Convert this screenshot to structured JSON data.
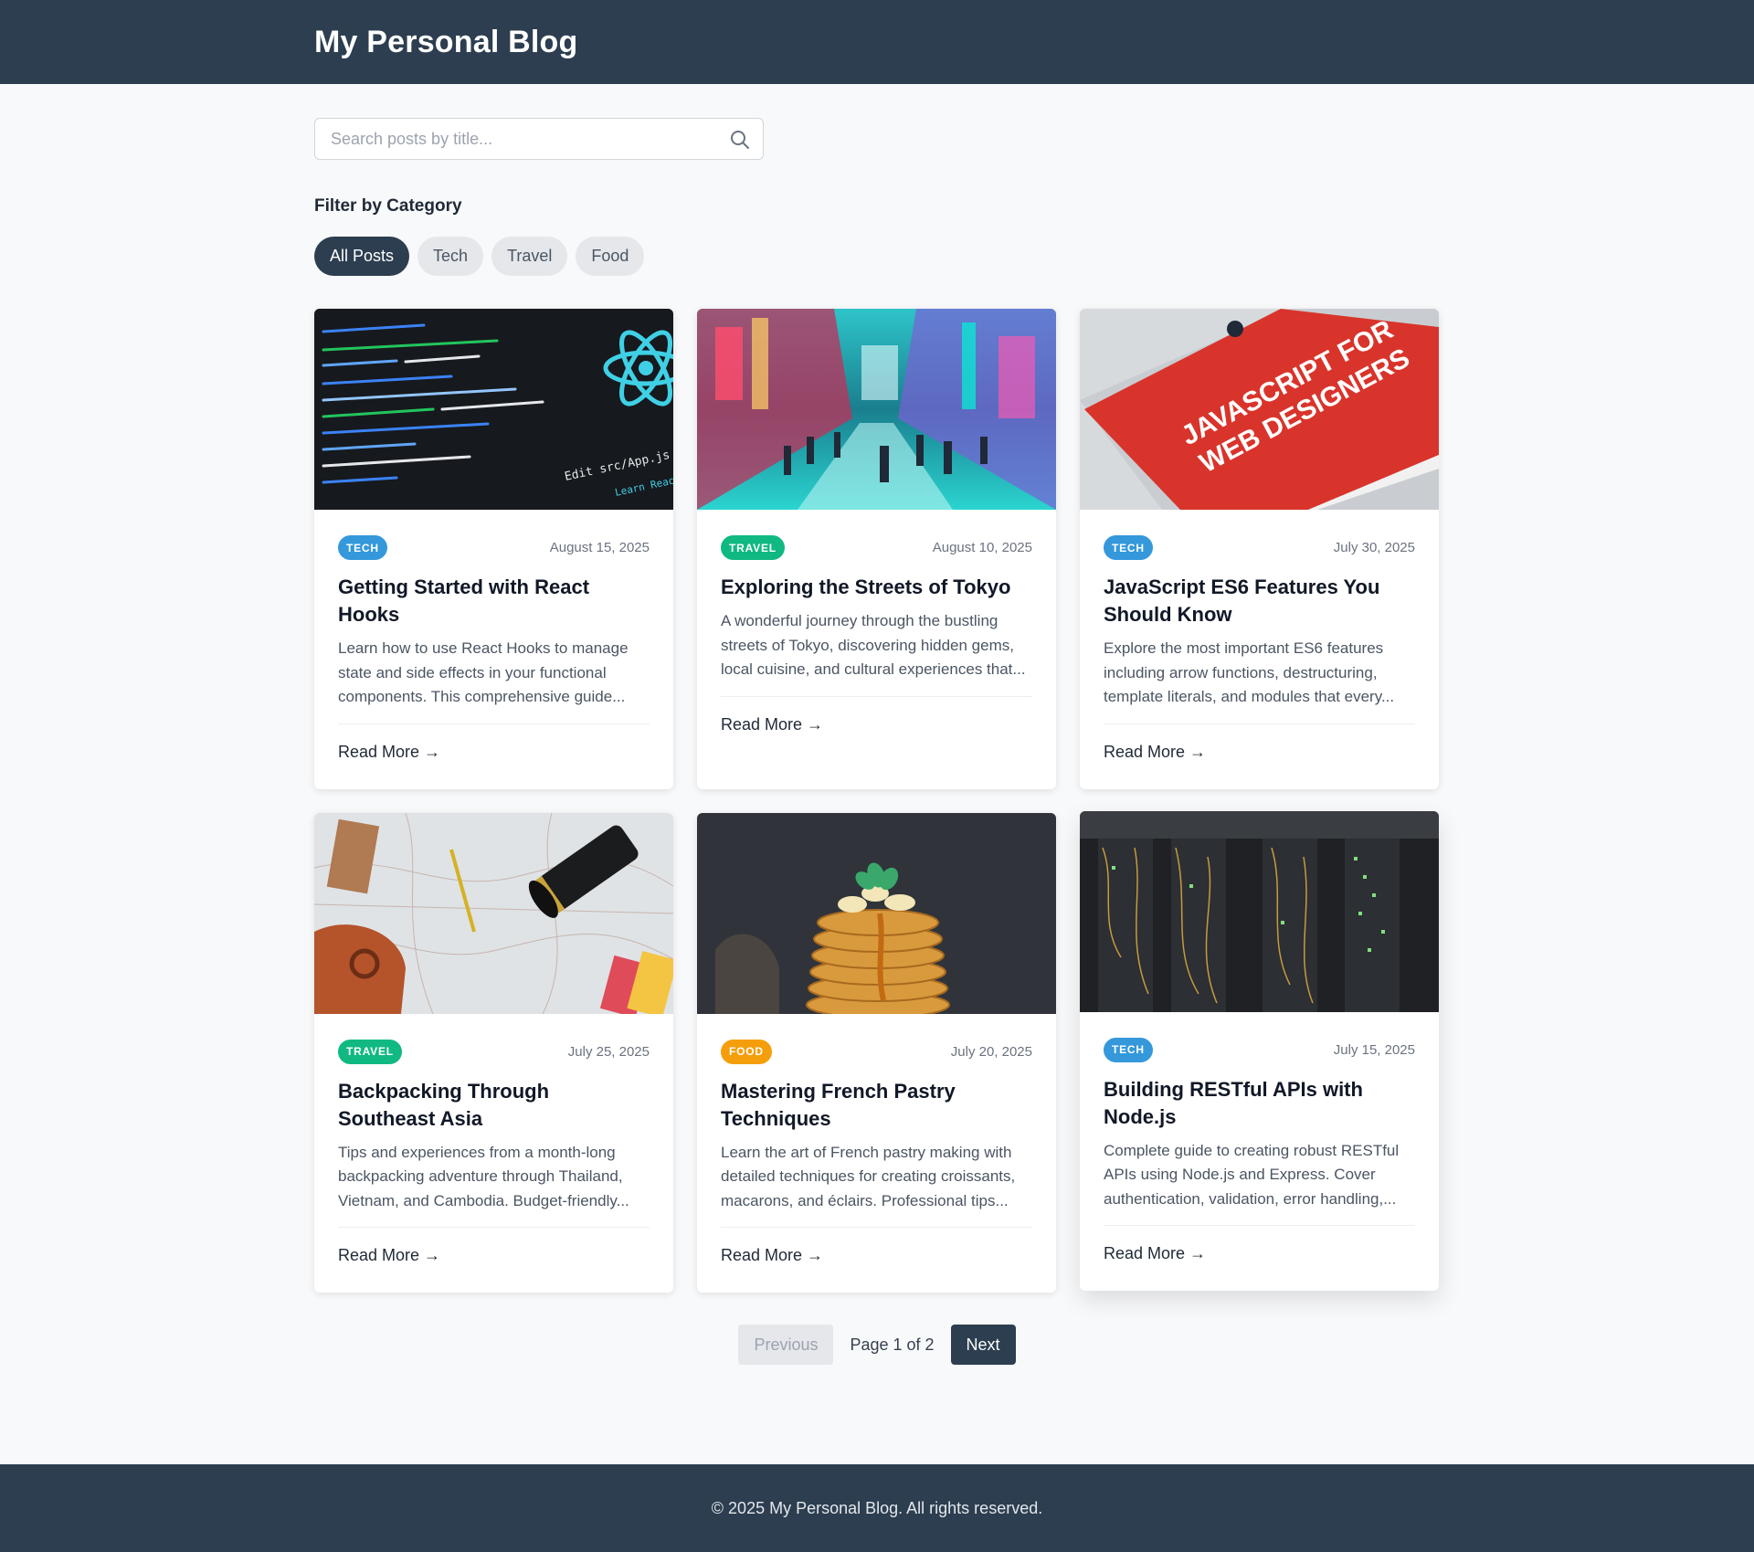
{
  "header": {
    "title": "My Personal Blog"
  },
  "search": {
    "placeholder": "Search posts by title..."
  },
  "filters": {
    "title": "Filter by Category",
    "items": [
      "All Posts",
      "Tech",
      "Travel",
      "Food"
    ],
    "active": "All Posts"
  },
  "colors": {
    "tech": "#3498db",
    "travel": "#10b981",
    "food": "#f59e0b",
    "primary": "#2c3e50"
  },
  "posts": [
    {
      "category": "TECH",
      "date": "August 15, 2025",
      "title": "Getting Started with React Hooks",
      "excerpt": "Learn how to use React Hooks to manage state and side effects in your functional components. This comprehensive guide...",
      "read_more": "Read More →",
      "image": "react-code-screen"
    },
    {
      "category": "TRAVEL",
      "date": "August 10, 2025",
      "title": "Exploring the Streets of Tokyo",
      "excerpt": "A wonderful journey through the bustling streets of Tokyo, discovering hidden gems, local cuisine, and cultural experiences that...",
      "read_more": "Read More →",
      "image": "tokyo-street"
    },
    {
      "category": "TECH",
      "date": "July 30, 2025",
      "title": "JavaScript ES6 Features You Should Know",
      "excerpt": "Explore the most important ES6 features including arrow functions, destructuring, template literals, and modules that every...",
      "read_more": "Read More →",
      "image": "javascript-book"
    },
    {
      "category": "TRAVEL",
      "date": "July 25, 2025",
      "title": "Backpacking Through Southeast Asia",
      "excerpt": "Tips and experiences from a month-long backpacking adventure through Thailand, Vietnam, and Cambodia. Budget-friendly...",
      "read_more": "Read More →",
      "image": "travel-map"
    },
    {
      "category": "FOOD",
      "date": "July 20, 2025",
      "title": "Mastering French Pastry Techniques",
      "excerpt": "Learn the art of French pastry making with detailed techniques for creating croissants, macarons, and éclairs. Professional tips...",
      "read_more": "Read More →",
      "image": "pancake-stack"
    },
    {
      "category": "TECH",
      "date": "July 15, 2025",
      "title": "Building RESTful APIs with Node.js",
      "excerpt": "Complete guide to creating robust RESTful APIs using Node.js and Express. Cover authentication, validation, error handling,...",
      "read_more": "Read More →",
      "image": "server-rack"
    }
  ],
  "pagination": {
    "previous": "Previous",
    "info": "Page 1 of 2",
    "next": "Next"
  },
  "footer": {
    "text": "© 2025 My Personal Blog. All rights reserved."
  }
}
